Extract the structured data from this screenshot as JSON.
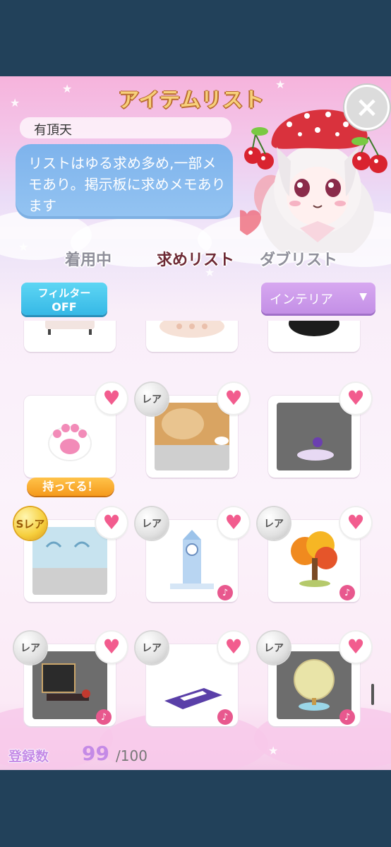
{
  "window": {
    "title": "アイテムリスト"
  },
  "profile": {
    "name": "有頂天",
    "message": "リストはゆる求め多め,一部メモあり。掲示板に求めメモあります"
  },
  "tabs": [
    {
      "label": "着用中",
      "active": false
    },
    {
      "label": "求めリスト",
      "active": true
    },
    {
      "label": "ダブリスト",
      "active": false
    }
  ],
  "filter": {
    "line1": "フィルター",
    "line2": "OFF"
  },
  "category": {
    "selected": "インテリア"
  },
  "badges": {
    "rare": "レア",
    "srare": "Sレア",
    "owned": "持ってる！"
  },
  "items": [
    {
      "rarity": "",
      "favorite": false,
      "owned": false,
      "music": false,
      "icon": "sofa-icon"
    },
    {
      "rarity": "",
      "favorite": false,
      "owned": false,
      "music": false,
      "icon": "rug-icon"
    },
    {
      "rarity": "",
      "favorite": false,
      "owned": false,
      "music": false,
      "icon": "black-object-icon"
    },
    {
      "rarity": "",
      "favorite": true,
      "owned": true,
      "music": false,
      "icon": "paw-icon"
    },
    {
      "rarity": "レア",
      "favorite": true,
      "owned": false,
      "music": false,
      "icon": "animal-icon"
    },
    {
      "rarity": "",
      "favorite": true,
      "owned": false,
      "music": false,
      "icon": "moon-icon"
    },
    {
      "rarity": "Sレア",
      "favorite": true,
      "owned": false,
      "music": false,
      "icon": "wall-decor-icon"
    },
    {
      "rarity": "レア",
      "favorite": true,
      "owned": false,
      "music": true,
      "icon": "clock-tower-icon"
    },
    {
      "rarity": "レア",
      "favorite": true,
      "owned": false,
      "music": true,
      "icon": "autumn-tree-icon"
    },
    {
      "rarity": "レア",
      "favorite": true,
      "owned": false,
      "music": true,
      "icon": "stage-icon"
    },
    {
      "rarity": "レア",
      "favorite": true,
      "owned": false,
      "music": true,
      "icon": "piano-icon"
    },
    {
      "rarity": "レア",
      "favorite": true,
      "owned": false,
      "music": true,
      "icon": "globe-icon"
    }
  ],
  "footer": {
    "label": "登録数",
    "count": "99",
    "max": "/100"
  },
  "colors": {
    "accent": "#c48ae6",
    "heart": "#f25c8e",
    "filter": "#36b8e6",
    "bubble": "#7eb3ec"
  }
}
